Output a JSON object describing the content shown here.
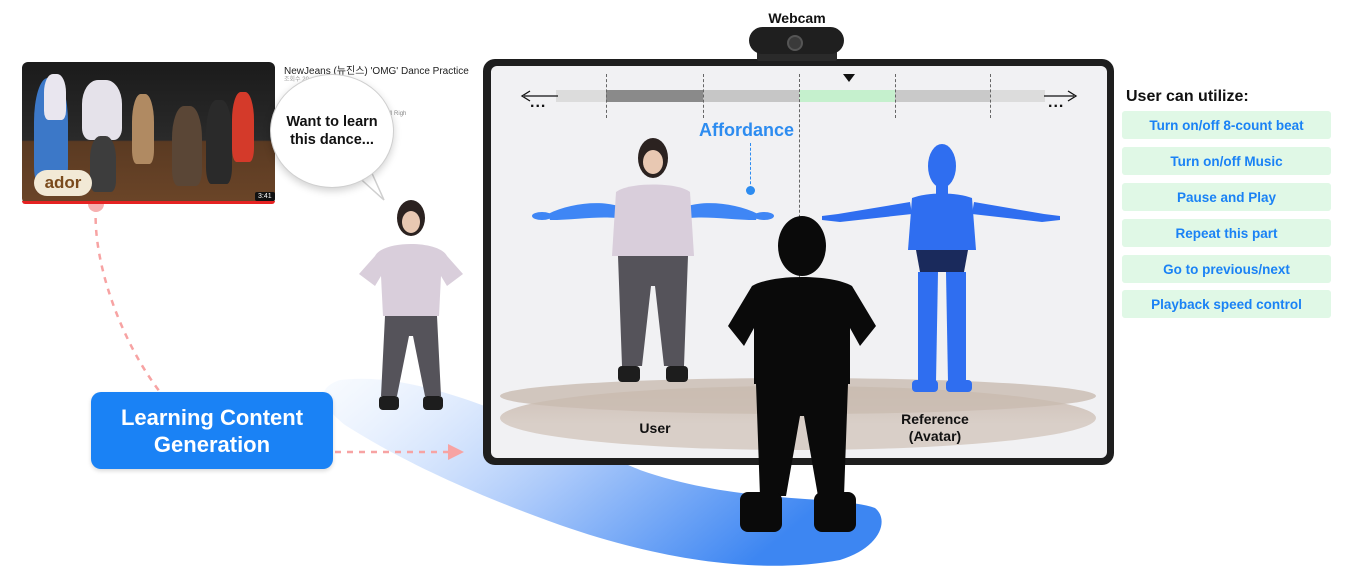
{
  "video": {
    "title": "NewJeans (뉴진스) 'OMG' Dance Practice",
    "meta": "조회수 20…",
    "copyright": "c 2023 ADOR. All Righ",
    "logo": "ador",
    "duration": "3:41"
  },
  "bubble": {
    "text": "Want to learn\nthis dance..."
  },
  "learning": {
    "label": "Learning Content\nGeneration"
  },
  "webcam": {
    "label": "Webcam"
  },
  "screen": {
    "affordance": "Affordance",
    "user_label": "User",
    "reference_label": "Reference\n(Avatar)",
    "ellipsis_left": "...",
    "ellipsis_right": "..."
  },
  "panel": {
    "title": "User can utilize:",
    "items": [
      "Turn on/off 8-count beat",
      "Turn on/off Music",
      "Pause and Play",
      "Repeat this part",
      "Go to previous/next",
      "Playback speed control"
    ]
  },
  "colors": {
    "accent_blue": "#1a82f5",
    "affordance_blue": "#2d8cf0",
    "item_bg": "#e0f8e6",
    "avatar_blue": "#2f6ef0",
    "dashed_arrow": "#f7a3a3"
  }
}
